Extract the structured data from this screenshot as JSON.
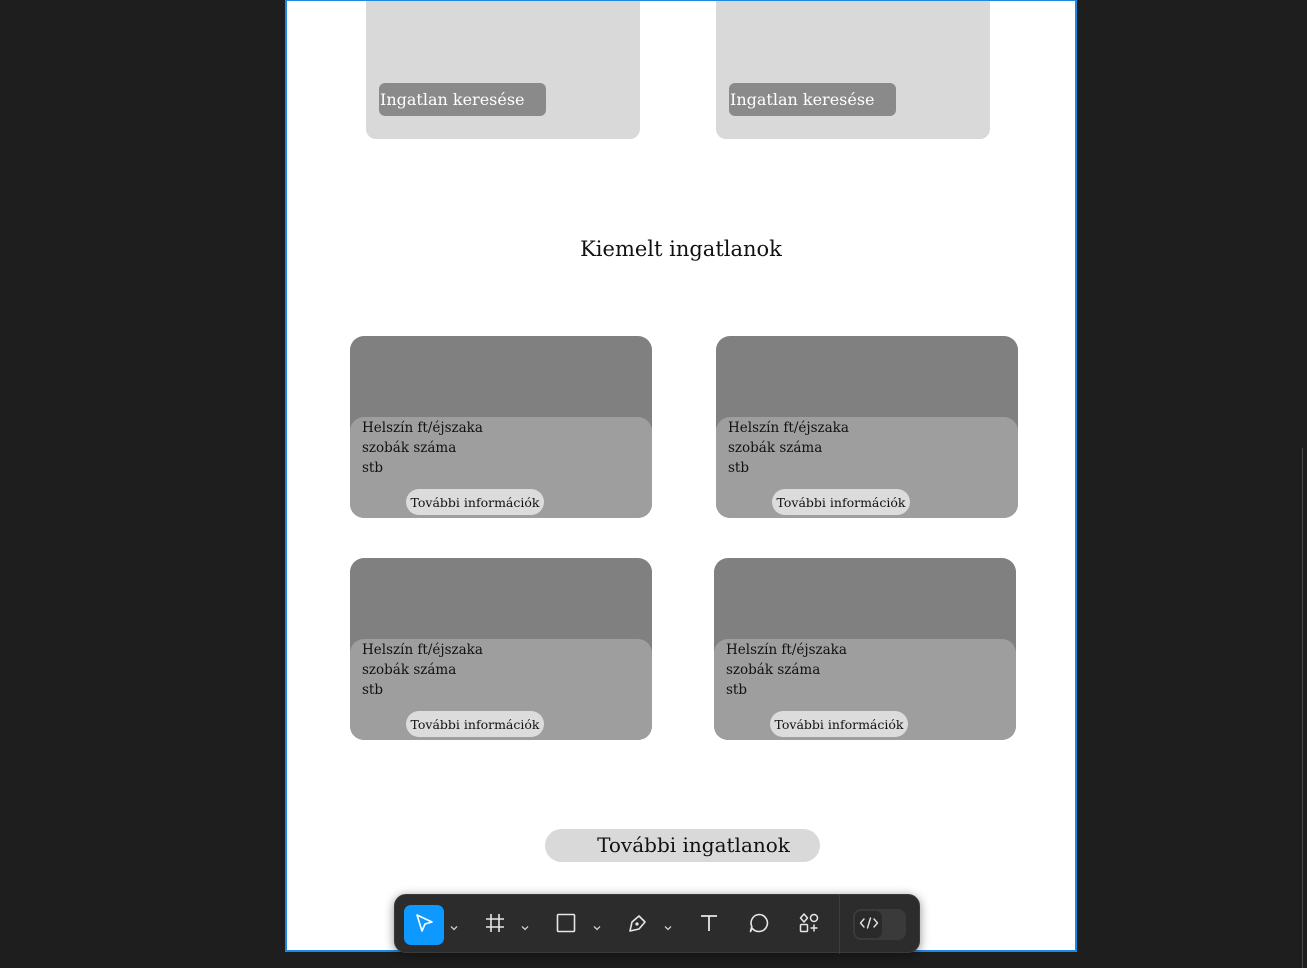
{
  "search_cards": [
    {
      "button_label": "Ingatlan keresése"
    },
    {
      "button_label": "Ingatlan keresése"
    }
  ],
  "section_title": "Kiemelt ingatlanok",
  "properties": [
    {
      "line1": "Helszín ft/éjszaka",
      "line2": "szobák száma",
      "line3": "stb",
      "button_label": "További információk"
    },
    {
      "line1": "Helszín ft/éjszaka",
      "line2": "szobák száma",
      "line3": "stb",
      "button_label": "További információk"
    },
    {
      "line1": "Helszín ft/éjszaka",
      "line2": "szobák száma",
      "line3": "stb",
      "button_label": "További információk"
    },
    {
      "line1": "Helszín ft/éjszaka",
      "line2": "szobák száma",
      "line3": "stb",
      "button_label": "További információk"
    }
  ],
  "more_button_label": "További ingatlanok",
  "toolbar": {
    "tools": [
      "move-icon",
      "frame-icon",
      "rectangle-icon",
      "pen-icon",
      "text-icon",
      "comment-icon",
      "components-icon"
    ],
    "active_tool": "move-icon",
    "dev_mode_icon": "code-icon"
  },
  "colors": {
    "canvas": "#1e1e1e",
    "frame_border": "#1e88e5",
    "accent": "#0d99ff",
    "card_dark": "#808080",
    "card_light": "#9e9e9e",
    "placeholder": "#d9d9d9"
  }
}
